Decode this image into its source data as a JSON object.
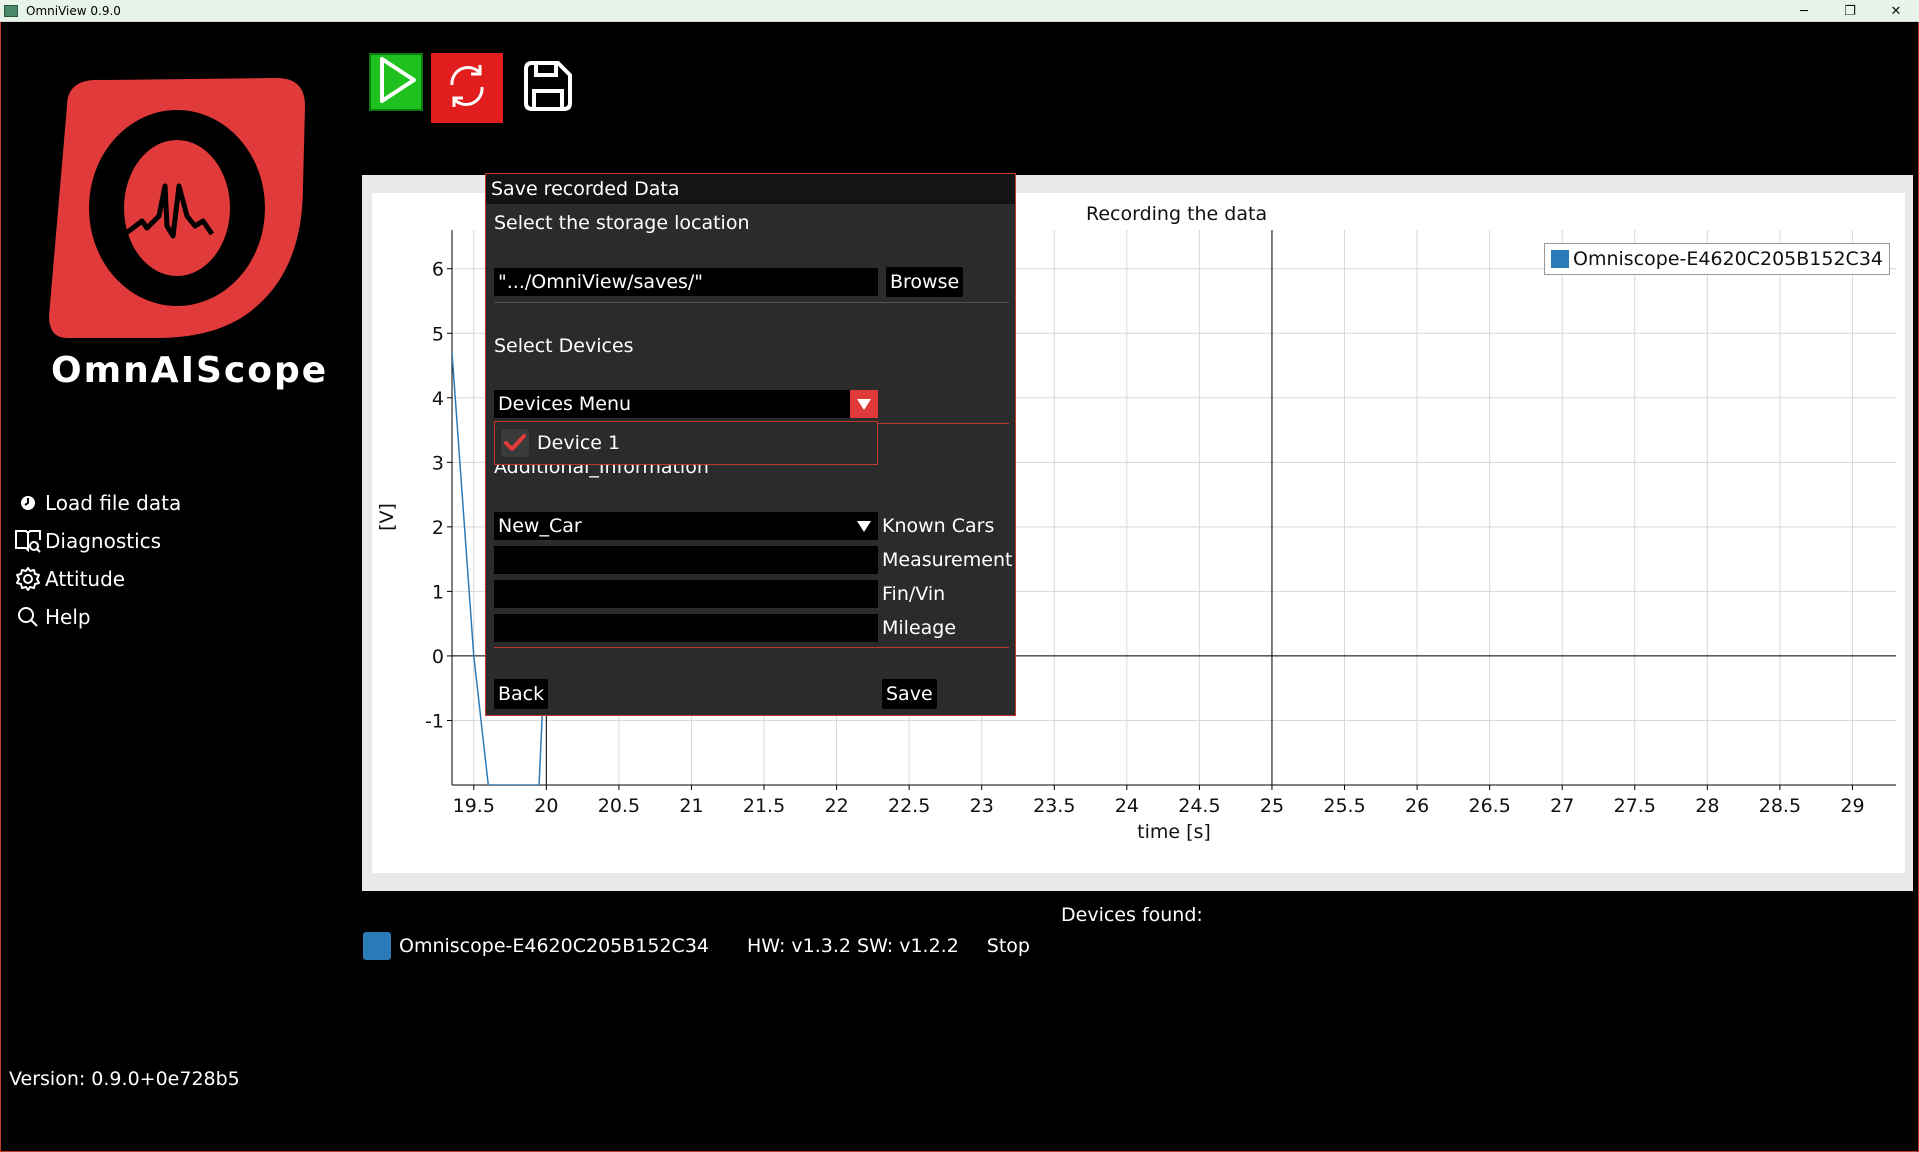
{
  "window": {
    "title": "OmniView 0.9.0",
    "controls": [
      "─",
      "❐",
      "✕"
    ]
  },
  "sidebar": {
    "brand": "OmnAIScope",
    "items": [
      {
        "label": "Load file data",
        "icon": "clock-icon"
      },
      {
        "label": "Diagnostics",
        "icon": "book-search-icon"
      },
      {
        "label": "Attitude",
        "icon": "gear-icon"
      },
      {
        "label": "Help",
        "icon": "search-icon"
      }
    ],
    "version": "Version: 0.9.0+0e728b5"
  },
  "toolbar": {
    "play": "play-icon",
    "refresh": "refresh-icon",
    "save": "save-icon"
  },
  "chart_data": {
    "type": "line",
    "title": "Recording the data",
    "xlabel": "time [s]",
    "ylabel": "[V]",
    "xlim": [
      19.35,
      29.3
    ],
    "ylim": [
      -2,
      6.6
    ],
    "xticks": [
      "19.5",
      "20",
      "20.5",
      "21",
      "21.5",
      "22",
      "22.5",
      "23",
      "23.5",
      "24",
      "24.5",
      "25",
      "25.5",
      "26",
      "26.5",
      "27",
      "27.5",
      "28",
      "28.5",
      "29"
    ],
    "yticks": [
      "6",
      "5",
      "4",
      "3",
      "2",
      "1",
      "0",
      "-1"
    ],
    "grid": true,
    "legend": "top-right",
    "series": [
      {
        "name": "Omniscope-E4620C205B152C34",
        "color": "#2a7ab8",
        "x": [
          19.35,
          19.5,
          19.6,
          19.95,
          19.98
        ],
        "y": [
          4.7,
          0,
          -2.0,
          -2.0,
          -0.5
        ]
      }
    ]
  },
  "devices": {
    "title": "Devices found:",
    "list": [
      {
        "name": "Omniscope-E4620C205B152C34",
        "version": "HW: v1.3.2 SW: v1.2.2",
        "action": "Stop",
        "color": "#2a7ab8"
      }
    ]
  },
  "dialog": {
    "title": "Save recorded Data",
    "storage_label": "Select the storage location",
    "storage_path": "\".../OmniView/saves/\"",
    "browse": "Browse",
    "devices_label": "Select Devices",
    "devices_menu": "Devices Menu",
    "device_option": "Device 1",
    "additional_info": "Additional_Information",
    "car_value": "New_Car",
    "known_cars": "Known Cars",
    "measurement": "Measurement",
    "fin_vin": "Fin/Vin",
    "mileage": "Mileage",
    "back": "Back",
    "save": "Save"
  }
}
